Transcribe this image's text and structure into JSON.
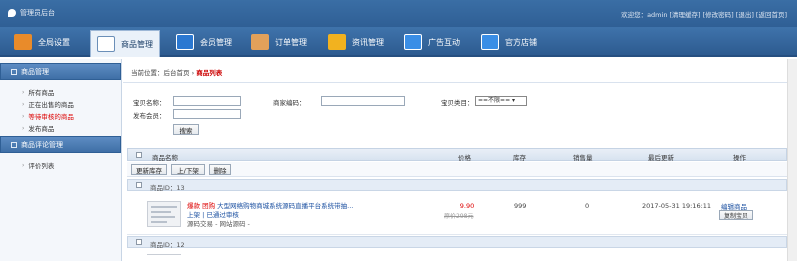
{
  "topbar": {
    "logo": "管理员后台",
    "welcome": "欢迎您：admin [清理缓存] [修改密码] [退出] [返回首页]"
  },
  "nav": [
    {
      "label": "全局设置",
      "icon": "gear-icon",
      "color": "#e98b2a"
    },
    {
      "label": "商品管理",
      "icon": "grid-icon",
      "color": "#ffffff",
      "active": true
    },
    {
      "label": "会员管理",
      "icon": "user-card-icon",
      "color": "#2b78d1"
    },
    {
      "label": "订单管理",
      "icon": "order-icon",
      "color": "#e2a15a"
    },
    {
      "label": "资讯管理",
      "icon": "news-icon",
      "color": "#f2b21f"
    },
    {
      "label": "广告互动",
      "icon": "ad-icon",
      "color": "#3a8ee6"
    },
    {
      "label": "官方店铺",
      "icon": "shop-icon",
      "color": "#3a8ee6"
    }
  ],
  "sidebar": {
    "section1": "商品管理",
    "items1": [
      "所有商品",
      "正在出售的商品",
      "等待审核的商品",
      "发布商品"
    ],
    "section2": "商品评论管理",
    "items2": [
      "评价列表"
    ]
  },
  "main": {
    "breadcrumb_prefix": "当前位置：后台首页",
    "breadcrumb_sep": "›",
    "breadcrumb_current": "商品列表",
    "filters": {
      "name_label": "宝贝名称：",
      "code_label": "商家编码：",
      "category_label": "宝贝类目：",
      "category_value": "==不限==",
      "publisher_label": "发布会员：",
      "search_button": "搜索"
    },
    "table": {
      "columns": [
        "商品名称",
        "价格",
        "库存",
        "销售量",
        "最后更新",
        "操作"
      ],
      "tools": [
        "更新库存",
        "上/下架",
        "删除"
      ],
      "group1": "商品ID：13",
      "group2": "商品ID：12",
      "product": {
        "tag": "爆款 团购",
        "title": "大型网络购物商城系统源码直播平台系统带抽...",
        "status_a": "上架",
        "status_sep": "|",
        "status_b": "已通过审核",
        "meta": "源码交易 - 网站源码 -",
        "price": "9.90",
        "orig_price": "原价298元",
        "stock": "999",
        "sales": "0",
        "updated": "2017-05-31 19:16:11",
        "edit": "编辑商品",
        "copy": "复制宝贝"
      }
    }
  }
}
